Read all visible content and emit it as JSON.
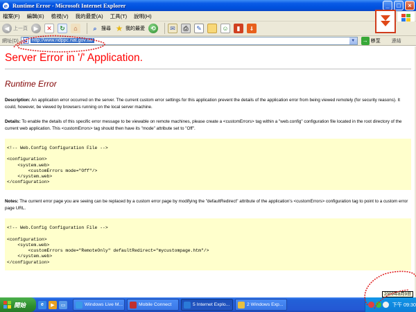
{
  "window": {
    "title": "Runtime Error - Microsoft Internet Explorer",
    "buttons": {
      "minimize": "_",
      "maximize": "□",
      "close": "×"
    }
  },
  "menu": {
    "items": [
      "檔案(F)",
      "編輯(E)",
      "檢視(V)",
      "我的最愛(A)",
      "工具(T)",
      "說明(H)"
    ]
  },
  "toolbar": {
    "back_label": "上一頁",
    "search_label": "搜尋",
    "favorites_label": "我的最愛"
  },
  "address": {
    "label": "網址(D)",
    "url": "http://www.ndppc.nat.gov.tw/",
    "go_label": "移至",
    "links_label": "連結"
  },
  "page": {
    "heading": "Server Error in '/' Application.",
    "subheading": "Runtime Error",
    "description_label": "Description:",
    "description_text": " An application error occurred on the server. The current custom error settings for this application prevent the details of the application error from being viewed remotely (for security reasons). It could, however, be viewed by browsers running on the local server machine.",
    "details_label": "Details:",
    "details_text": " To enable the details of this specific error message to be viewable on remote machines, please create a <customErrors> tag within a \"web.config\" configuration file located in the root directory of the current web application. This <customErrors> tag should then have its \"mode\" attribute set to \"Off\".",
    "code1": "<!-- Web.Config Configuration File -->\n\n<configuration>\n    <system.web>\n        <customErrors mode=\"Off\"/>\n    </system.web>\n</configuration>",
    "notes_label": "Notes:",
    "notes_text": " The current error page you are seeing can be replaced by a custom error page by modifying the \"defaultRedirect\" attribute of the application's <customErrors> configuration tag to point to a custom error page URL.",
    "code2": "<!-- Web.Config Configuration File -->\n\n<configuration>\n    <system.web>\n        <customErrors mode=\"RemoteOnly\" defaultRedirect=\"mycustompage.htm\"/>\n    </system.web>\n</configuration>"
  },
  "taskbar": {
    "start_label": "開始",
    "tasks": [
      {
        "label": "Windows Live M...",
        "icon_color": "#3a9ae8",
        "active": false
      },
      {
        "label": "Mobile Connect",
        "icon_color": "#c03030",
        "active": false
      },
      {
        "label": "5 Internet Explo...",
        "icon_color": "#2a7ad8",
        "active": true
      },
      {
        "label": "2 Windows Exp...",
        "icon_color": "#e8c040",
        "active": false
      }
    ],
    "clock": "下午 09:30",
    "date_tooltip": "2009年8月9日"
  },
  "colors": {
    "heading": "#ff0000",
    "subheading": "#800000",
    "code_bg": "#ffffcc",
    "annotation": "#e02020"
  }
}
